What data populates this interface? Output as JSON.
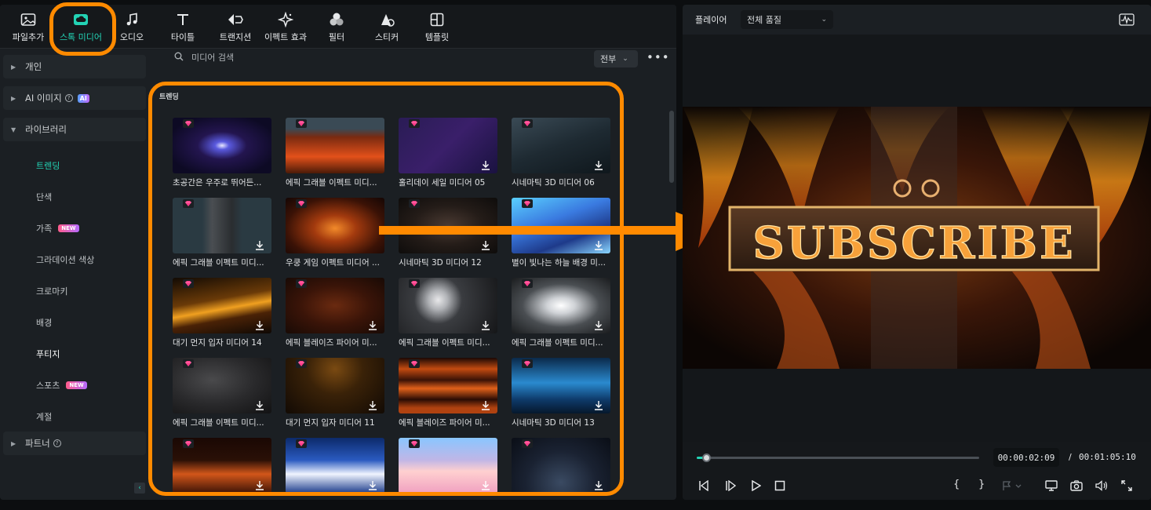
{
  "toolbar": {
    "items": [
      {
        "label": "파일추가",
        "icon": "image-import-icon"
      },
      {
        "label": "스톡 미디어",
        "icon": "cloud-media-icon",
        "active": true
      },
      {
        "label": "오디오",
        "icon": "music-note-icon"
      },
      {
        "label": "타이틀",
        "icon": "text-t-icon"
      },
      {
        "label": "트랜지션",
        "icon": "transition-icon"
      },
      {
        "label": "이펙트 효과",
        "icon": "sparkle-effect-icon"
      },
      {
        "label": "필터",
        "icon": "filter-circles-icon"
      },
      {
        "label": "스티커",
        "icon": "sticker-icon"
      },
      {
        "label": "템플릿",
        "icon": "template-icon"
      }
    ]
  },
  "sidebar": {
    "groups": {
      "personal": "개인",
      "ai_image": "AI 이미지",
      "ai_badge": "AI",
      "library": "라이브러리",
      "partner": "파트너"
    },
    "items": [
      {
        "label": "트렌딩",
        "active": true
      },
      {
        "label": "단색"
      },
      {
        "label": "가족",
        "badge": "NEW"
      },
      {
        "label": "그라데이션 색상"
      },
      {
        "label": "크로마키"
      },
      {
        "label": "배경"
      },
      {
        "label": "푸티지",
        "bold": true
      },
      {
        "label": "스포츠",
        "badge": "NEW"
      },
      {
        "label": "계절"
      }
    ],
    "collapse_icon": "chevron-left-icon"
  },
  "content": {
    "search_placeholder": "미디어 검색",
    "filter_label": "전부",
    "more_label": "•••",
    "section_title": "트렌딩",
    "tiles": [
      {
        "title": "초공간은 우주로 뛰어든...",
        "bg": "radial-gradient(ellipse at 50% 50%, #e8e8ff 0%, #5a5adf 10%, #23154f 35%, #0d0a24 80%)",
        "dl": false
      },
      {
        "title": "에픽 그래블 이펙트 미디...",
        "bg": "linear-gradient(180deg, #3a4a55 0%, #3a4a55 20%, #7a2a10 35%, #e2501a 70%, #4a1a08 100%)",
        "dl": false
      },
      {
        "title": "홀리데이 세일 미디어 05",
        "bg": "linear-gradient(135deg, #2a1c55 0%, #3a1f6a 50%, #1a1240 100%)",
        "dl": true
      },
      {
        "title": "시네마틱 3D 미디어 06",
        "bg": "linear-gradient(160deg, #3a4a55 0%, #1e2a32 50%, #0f171c 100%)",
        "dl": true
      },
      {
        "title": "에픽 그래블 이펙트 미디...",
        "bg": "linear-gradient(90deg, #2a3a42 0%, #2a3a42 30%, #4a4e52 40%, #2a2d30 60%, #2a3a42 70%)",
        "dl": true
      },
      {
        "title": "우쿵 게임 이펙트 미디어 ...",
        "bg": "radial-gradient(ellipse at 50% 55%, #f28a2a 0%, #a33a0e 30%, #3a1206 70%, #140604 100%)",
        "dl": false
      },
      {
        "title": "시네마틱 3D 미디어 12",
        "bg": "radial-gradient(ellipse at 50% 50%, #4a3a32 0%, #241c18 50%, #0e0c0b 100%)",
        "dl": true
      },
      {
        "title": "별이 빛나는 하늘 배경 미...",
        "bg": "linear-gradient(160deg, #5ad0ff 0%, #3a7ae0 40%, #1e3a8a 70%, #8ad6ff 100%)",
        "dl": true
      },
      {
        "title": "대기 먼지 입자 미디어 14",
        "bg": "linear-gradient(170deg, #120a04 0%, #6a3a08 40%, #f0a020 55%, #4a2206 70%, #0e0804 100%)",
        "dl": true
      },
      {
        "title": "에픽 블레이즈 파이어 미...",
        "bg": "radial-gradient(ellipse at 50% 50%, #6a2a10 0%, #3a1408 50%, #180a05 100%)",
        "dl": true
      },
      {
        "title": "에픽 그래블 이펙트 미디...",
        "bg": "radial-gradient(circle at 40% 40%, #e8e8ea 0%, #b0b2b6 14%, #3a3c40 35%, #151618 100%)",
        "dl": true
      },
      {
        "title": "에픽 그래블 이펙트 미디...",
        "bg": "radial-gradient(ellipse at 50% 50%, #ffffff 0%, #cfd2d6 20%, #4a4e52 55%, #1a1c1e 100%)",
        "dl": true
      },
      {
        "title": "에픽 그래블 이펙트 미디...",
        "bg": "radial-gradient(ellipse at 40% 40%, #4a4a4c 0%, #2a2a2c 50%, #121213 100%)",
        "dl": true
      },
      {
        "title": "대기 먼지 입자 미디어 11",
        "bg": "radial-gradient(ellipse at 50% 20%, #7a4a12 0%, #3a2208 40%, #120a04 100%)",
        "dl": true
      },
      {
        "title": "에픽 블레이즈 파이어 미...",
        "bg": "linear-gradient(180deg, #1a0804 0%, #c24a10 20%, #3a1206 40%, #e0601a 55%, #2a0c04 75%, #b04210 90%)",
        "dl": true
      },
      {
        "title": "시네마틱 3D 미디어 13",
        "bg": "linear-gradient(180deg, #0a2a4a 0%, #2a8acf 45%, #0e3a6a 75%, #06182c 100%)",
        "dl": true
      },
      {
        "title": "",
        "bg": "linear-gradient(180deg, #1a0804 0%, #2a1006 40%, #d2561a 65%, #3a1206 100%)",
        "dl": true
      },
      {
        "title": "",
        "bg": "linear-gradient(180deg, #0c2a6a 0%, #2a5ac0 40%, #f0f4ff 65%, #1a3a8a 100%)",
        "dl": true
      },
      {
        "title": "",
        "bg": "linear-gradient(180deg, #8ac6ff 0%, #c0b6e6 40%, #ffd0d0 60%, #f0a0c0 100%)",
        "dl": true
      },
      {
        "title": "",
        "bg": "radial-gradient(ellipse at 50% 80%, #3a4a62 0%, #1a2232 50%, #0a0e16 100%)",
        "dl": true
      }
    ]
  },
  "player": {
    "label": "플레이어",
    "quality": "전체 품질",
    "preview_text": "SUBSCRIBE",
    "current_time": "00:00:02:09",
    "separator": "/",
    "total_time": "00:01:05:10",
    "progress": 0.034,
    "brace_open": "{",
    "brace_close": "}"
  },
  "colors": {
    "accent": "#23d3b5",
    "highlight": "#ff8a00",
    "panel": "#1b1f23"
  }
}
